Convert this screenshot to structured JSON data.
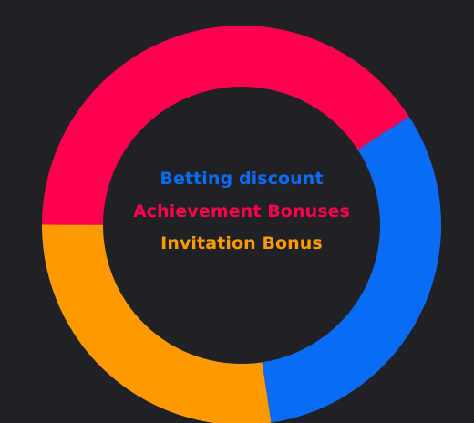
{
  "chart_data": {
    "type": "pie",
    "variant": "donut",
    "series": [
      {
        "name": "Betting discount",
        "value": 31.8,
        "color": "#0a6cf5"
      },
      {
        "name": "Invitation Bonus",
        "value": 27.4,
        "color": "#ff9900"
      },
      {
        "name": "Achievement Bonuses",
        "value": 40.8,
        "color": "#ff004f"
      }
    ],
    "start_angle_deg": -33,
    "legend": {
      "placement": "center",
      "items": [
        {
          "label": "Betting discount",
          "color": "#0a6cf5"
        },
        {
          "label": "Achievement Bonuses",
          "color": "#ff004f"
        },
        {
          "label": "Invitation Bonus",
          "color": "#ff9900"
        }
      ]
    }
  },
  "colors": {
    "background": "#202125"
  }
}
